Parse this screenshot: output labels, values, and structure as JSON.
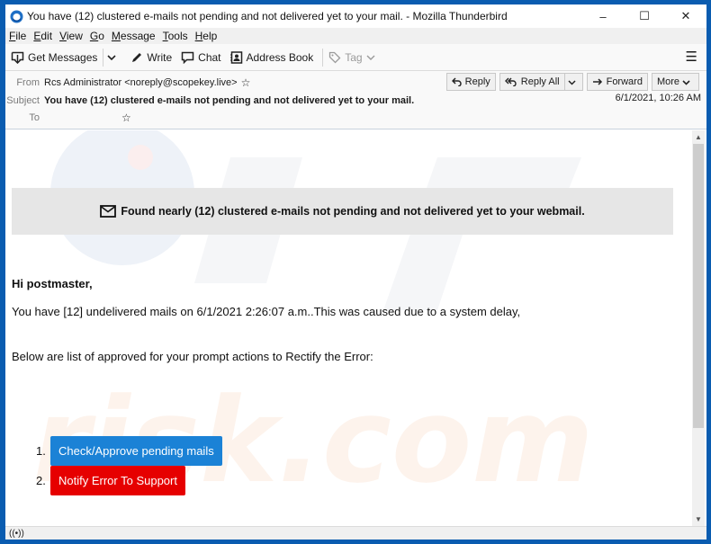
{
  "window": {
    "title": "You have (12) clustered e-mails not pending and not delivered yet to your mail. - Mozilla Thunderbird",
    "controls": {
      "minimize": "–",
      "maximize": "☐",
      "close": "✕"
    }
  },
  "menubar": {
    "items": [
      {
        "first": "F",
        "rest": "ile"
      },
      {
        "first": "E",
        "rest": "dit"
      },
      {
        "first": "V",
        "rest": "iew"
      },
      {
        "first": "G",
        "rest": "o"
      },
      {
        "first": "M",
        "rest": "essage"
      },
      {
        "first": "T",
        "rest": "ools"
      },
      {
        "first": "H",
        "rest": "elp"
      }
    ]
  },
  "toolbar": {
    "get_messages": "Get Messages",
    "write": "Write",
    "chat": "Chat",
    "address_book": "Address Book",
    "tag": "Tag",
    "menu_icon": "☰"
  },
  "header": {
    "from_label": "From",
    "from_value": "Rcs Administrator <noreply@scopekey.live>",
    "subject_label": "Subject",
    "subject_value": "You have (12) clustered e-mails not pending and not delivered yet to your mail.",
    "to_label": "To",
    "to_value": "",
    "date": "6/1/2021, 10:26 AM",
    "actions": {
      "reply": "Reply",
      "reply_all": "Reply All",
      "forward": "Forward",
      "more": "More"
    }
  },
  "message": {
    "banner": "Found nearly (12) clustered e-mails not pending and not delivered yet to your webmail.",
    "greeting": "Hi postmaster,",
    "line1": "You have [12] undelivered mails on 6/1/2021 2:26:07 a.m..This was caused due to a system delay,",
    "line2": "Below are list of approved for your prompt actions to Rectify the Error:",
    "list": [
      {
        "num": "1.",
        "label": "Check/Approve pending mails",
        "color": "#1b82d6"
      },
      {
        "num": "2.",
        "label": "Notify Error To Support",
        "color": "#e60000"
      }
    ]
  },
  "statusbar": {
    "icon": "((•))"
  },
  "colors": {
    "window_border": "#0a5cb0",
    "button_blue": "#1b82d6",
    "button_red": "#e60000",
    "banner_bg": "#e6e6e6"
  }
}
